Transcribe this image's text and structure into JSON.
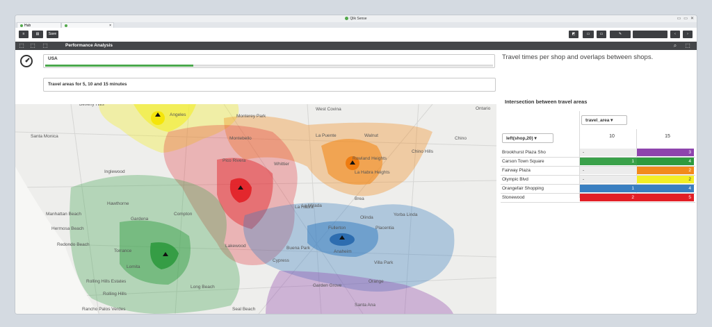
{
  "window": {
    "title": "Qlik Sense",
    "controls": [
      "▭",
      "▭",
      "✕"
    ]
  },
  "tabs": [
    {
      "label": "Hub"
    },
    {
      "label": ""
    }
  ],
  "toolbar": {
    "save_label": "Save"
  },
  "sheet": {
    "title": "Performance Analysis"
  },
  "filters": {
    "usa_label": "USA",
    "usa_selected_fraction": 0.33,
    "travel_label": "Travel areas for 5, 10 and 15 minutes"
  },
  "description": "Travel times per shop and overlaps between shops.",
  "pivot": {
    "title": "Intersection between travel areas",
    "dim_row": "left(shop,20)",
    "dim_col": "travel_area",
    "col_headers": [
      "10",
      "15"
    ],
    "rows": [
      {
        "name": "Brookhurst Plaza Sho",
        "v10": "-",
        "v15": "3",
        "c10": "#ececec",
        "c15": "#8e44ad"
      },
      {
        "name": "Carson Town Square",
        "v10": "1",
        "v15": "4",
        "c10": "#3aa14a",
        "c15": "#2e9a3e"
      },
      {
        "name": "Fairway Plaza",
        "v10": "-",
        "v15": "2",
        "c10": "#ececec",
        "c15": "#f28a1c"
      },
      {
        "name": "Olympic Blvd",
        "v10": "-",
        "v15": "2",
        "c10": "#ececec",
        "c15": "#f3ee26"
      },
      {
        "name": "Orangefair Shopping",
        "v10": "1",
        "v15": "4",
        "c10": "#3a7fc1",
        "c15": "#3a7fc1"
      },
      {
        "name": "Stonewood",
        "v10": "2",
        "v15": "5",
        "c10": "#e21f26",
        "c15": "#e21f26"
      }
    ]
  },
  "map": {
    "labels": [
      "Beverly Hills",
      "Angeles",
      "Monterey Park",
      "West Covina",
      "Ontario",
      "Santa Monica",
      "Montebello",
      "La Puente",
      "Walnut",
      "Chino",
      "Chino Hills",
      "Pico Rivera",
      "Whittier",
      "Rowland Heights",
      "Inglewood",
      "La Habra Heights",
      "Hawthorne",
      "La Habra",
      "Olinda",
      "Manhattan Beach",
      "La Mirada",
      "Yorba Linda",
      "Hermosa Beach",
      "Gardena",
      "Compton",
      "Brea",
      "Redondo Beach",
      "Fullerton",
      "Placentia",
      "Torrance",
      "Lakewood",
      "Buena Park",
      "Anaheim",
      "Lomita",
      "Cypress",
      "Villa Park",
      "Rolling Hills Estates",
      "Long Beach",
      "Orange",
      "Rolling Hills",
      "Garden Grove",
      "Rancho Palos Verdes",
      "Seal Beach",
      "Santa Ana"
    ]
  }
}
